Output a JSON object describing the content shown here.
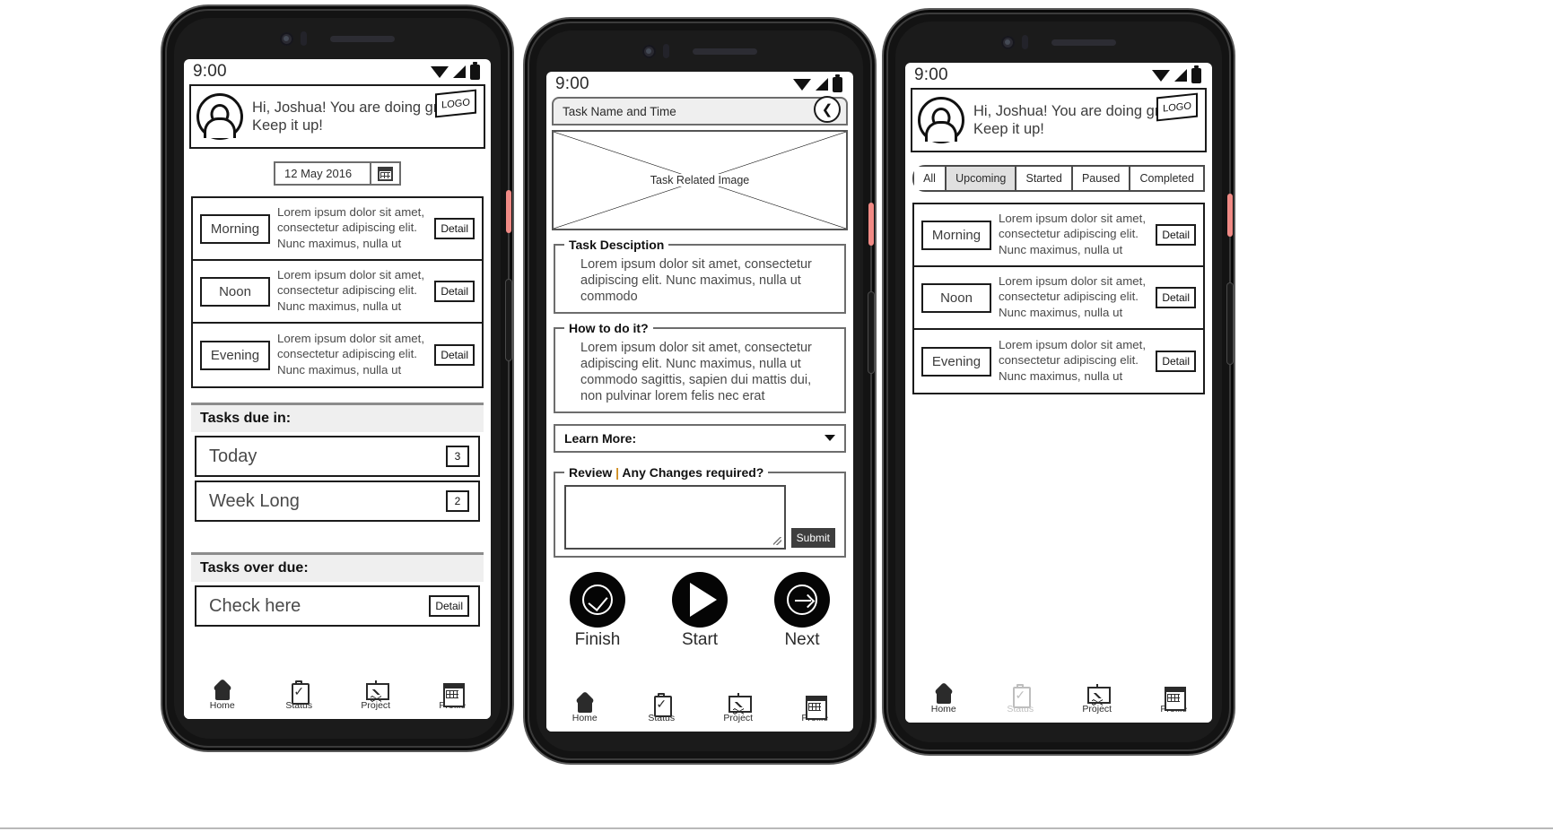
{
  "status_bar": {
    "time": "9:00",
    "icons": [
      "wifi-icon",
      "signal-icon",
      "battery-icon"
    ]
  },
  "greeting": {
    "text": "Hi, Joshua! You are doing great! Keep it up!",
    "logo_label": "LOGO",
    "avatar_name": "user-avatar"
  },
  "date_picker": {
    "value": "12 May 2016",
    "icon": "calendar-icon"
  },
  "task_rows": [
    {
      "time": "Morning",
      "desc": "Lorem ipsum dolor sit amet, consectetur adipiscing elit. Nunc maximus, nulla ut commodo",
      "detail_label": "Detail"
    },
    {
      "time": "Noon",
      "desc": "Lorem ipsum dolor sit amet, consectetur adipiscing elit. Nunc maximus, nulla ut commodo",
      "detail_label": "Detail"
    },
    {
      "time": "Evening",
      "desc": "Lorem ipsum dolor sit amet, consectetur adipiscing elit. Nunc maximus, nulla ut commodo",
      "detail_label": "Detail"
    }
  ],
  "due_section": {
    "heading": "Tasks due in:",
    "rows": [
      {
        "label": "Today",
        "count": "3"
      },
      {
        "label": "Week Long",
        "count": "2"
      }
    ]
  },
  "overdue_section": {
    "heading": "Tasks over due:",
    "row": {
      "label": "Check here",
      "detail_label": "Detail"
    }
  },
  "bottom_nav": [
    {
      "label": "Home",
      "icon": "home-icon"
    },
    {
      "label": "Status",
      "icon": "clipboard-check-icon"
    },
    {
      "label": "Project",
      "icon": "presentation-chart-icon"
    },
    {
      "label": "Profile",
      "icon": "calendar-icon"
    }
  ],
  "detail_screen": {
    "header": "Task Name and Time",
    "back_icon": "chevron-left-icon",
    "image_placeholder": "Task Related Image",
    "description": {
      "legend": "Task Desciption",
      "text": "Lorem ipsum dolor sit amet, consectetur adipiscing elit. Nunc maximus, nulla ut commodo"
    },
    "how_to": {
      "legend": "How to do it?",
      "text": "Lorem ipsum dolor sit amet, consectetur adipiscing elit. Nunc maximus, nulla ut commodo sagittis, sapien dui mattis dui, non pulvinar lorem felis nec erat"
    },
    "learn_more": {
      "label": "Learn More:",
      "icon": "chevron-down-icon"
    },
    "review": {
      "legend_before": "Review ",
      "legend_caret": "|",
      "legend_after": " Any Changes required?",
      "textarea_value": "",
      "submit_label": "Submit"
    },
    "actions": [
      {
        "label": "Finish",
        "icon": "check-circle-icon"
      },
      {
        "label": "Start",
        "icon": "play-icon"
      },
      {
        "label": "Next",
        "icon": "arrow-right-circle-icon"
      }
    ]
  },
  "filter_screen": {
    "tabs": [
      {
        "label": "All",
        "active": false
      },
      {
        "label": "Upcoming",
        "active": true
      },
      {
        "label": "Started",
        "active": false
      },
      {
        "label": "Paused",
        "active": false
      },
      {
        "label": "Completed",
        "active": false
      }
    ]
  },
  "colors": {
    "accent_red_button": "#f08a85",
    "panel_gray": "#efefef",
    "active_tab_gray": "#e0e0e0",
    "ink": "#1b1b1b",
    "submit_bg": "#3e3e3e",
    "caret": "#cf8a1a"
  }
}
